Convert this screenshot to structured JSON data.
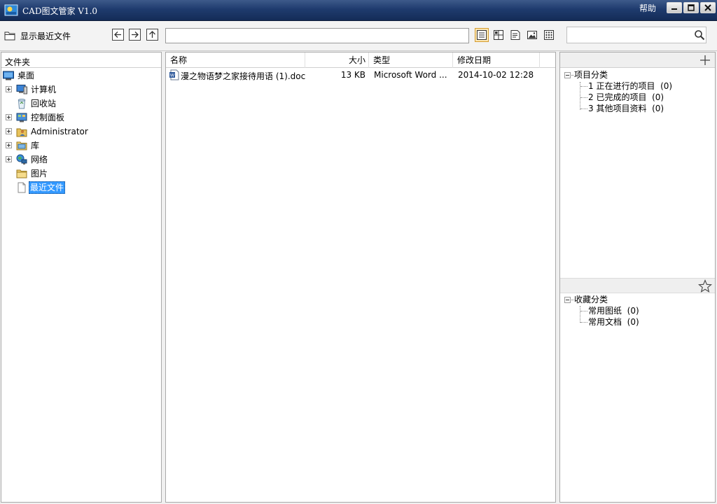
{
  "window": {
    "title": "CAD图文管家 V1.0",
    "help_label": "帮助"
  },
  "toolbar": {
    "show_recent_label": "显示最近文件",
    "path_value": "",
    "search_value": ""
  },
  "folder_pane": {
    "header": "文件夹",
    "items": [
      {
        "label": "桌面",
        "icon": "desktop-icon",
        "expandable": false
      },
      {
        "label": "计算机",
        "icon": "computer-icon",
        "expandable": true
      },
      {
        "label": "回收站",
        "icon": "recycle-bin-icon",
        "expandable": false
      },
      {
        "label": "控制面板",
        "icon": "control-panel-icon",
        "expandable": true
      },
      {
        "label": "Administrator",
        "icon": "user-folder-icon",
        "expandable": true
      },
      {
        "label": "库",
        "icon": "library-icon",
        "expandable": true
      },
      {
        "label": "网络",
        "icon": "network-icon",
        "expandable": true
      },
      {
        "label": "图片",
        "icon": "folder-icon",
        "expandable": false
      },
      {
        "label": "最近文件",
        "icon": "document-icon",
        "expandable": false,
        "selected": true
      }
    ]
  },
  "file_list": {
    "columns": {
      "name": "名称",
      "size": "大小",
      "type": "类型",
      "date": "修改日期"
    },
    "rows": [
      {
        "name": "漫之物语梦之家接待用语 (1).doc",
        "size": "13 KB",
        "type": "Microsoft Word ...",
        "date": "2014-10-02 12:28",
        "icon": "word-doc-icon"
      }
    ]
  },
  "categories": {
    "projects": {
      "title": "项目分类",
      "items": [
        {
          "label": "1 正在进行的项目",
          "count": "(0)"
        },
        {
          "label": "2 已完成的项目",
          "count": "(0)"
        },
        {
          "label": "3 其他项目资料",
          "count": "(0)"
        }
      ]
    },
    "favorites": {
      "title": "收藏分类",
      "items": [
        {
          "label": "常用图纸",
          "count": "(0)"
        },
        {
          "label": "常用文档",
          "count": "(0)"
        }
      ]
    }
  },
  "colors": {
    "titlebar": "#1f3b6e",
    "selection": "#3399ff",
    "active_view_bg": "#fde8b5"
  }
}
